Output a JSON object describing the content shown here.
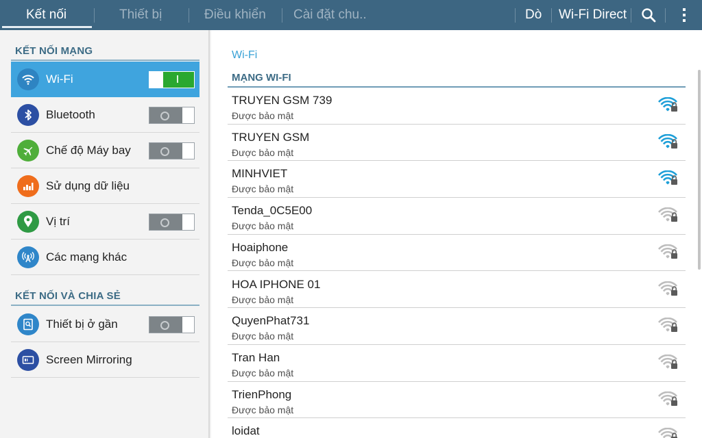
{
  "tabs": [
    {
      "label": "Kết nối",
      "active": true
    },
    {
      "label": "Thiết bị",
      "active": false
    },
    {
      "label": "Điều khiển",
      "active": false
    },
    {
      "label": "Cài đặt chu..",
      "active": false
    }
  ],
  "actions": {
    "scan_label": "Dò",
    "wifi_direct_label": "Wi-Fi Direct",
    "search_icon": "search-icon",
    "overflow_icon": "more-vert-icon"
  },
  "sidebar": {
    "section1": "KẾT NỐI MẠNG",
    "section2": "KẾT NỐI VÀ CHIA SẺ",
    "items": [
      {
        "label": "Wi-Fi",
        "icon": "wifi-icon",
        "toggle": "on",
        "selected": true
      },
      {
        "label": "Bluetooth",
        "icon": "bluetooth-icon",
        "toggle": "off"
      },
      {
        "label": "Chế độ Máy bay",
        "icon": "airplane-icon",
        "toggle": "off"
      },
      {
        "label": "Sử dụng dữ liệu",
        "icon": "data-usage-icon"
      },
      {
        "label": "Vị trí",
        "icon": "location-icon",
        "toggle": "off"
      },
      {
        "label": "Các mạng khác",
        "icon": "antenna-icon"
      },
      {
        "label": "Thiết bị ở gần",
        "icon": "nearby-device-icon",
        "toggle": "off"
      },
      {
        "label": "Screen Mirroring",
        "icon": "screen-mirroring-icon"
      }
    ]
  },
  "wifi": {
    "title": "Wi-Fi",
    "header": "MẠNG WI-FI",
    "networks": [
      {
        "name": "TRUYEN GSM 739",
        "status": "Được bảo mật",
        "signal": "strong"
      },
      {
        "name": "TRUYEN GSM",
        "status": "Được bảo mật",
        "signal": "strong"
      },
      {
        "name": "MINHVIET",
        "status": "Được bảo mật",
        "signal": "strong"
      },
      {
        "name": "Tenda_0C5E00",
        "status": "Được bảo mật",
        "signal": "weak"
      },
      {
        "name": "Hoaiphone",
        "status": "Được bảo mật",
        "signal": "weak"
      },
      {
        "name": "HOA IPHONE 01",
        "status": "Được bảo mật",
        "signal": "weak"
      },
      {
        "name": "QuyenPhat731",
        "status": "Được bảo mật",
        "signal": "weak"
      },
      {
        "name": "Tran Han",
        "status": "Được bảo mật",
        "signal": "weak"
      },
      {
        "name": "TrienPhong",
        "status": "Được bảo mật",
        "signal": "weak"
      },
      {
        "name": "loidat",
        "status": "",
        "signal": "weak"
      }
    ]
  },
  "colors": {
    "topbar": "#3d6682",
    "accent": "#3fa4de",
    "toggle_on": "#2aa830",
    "signal_strong": "#1e9fd8",
    "signal_weak": "#bdbdbd"
  }
}
